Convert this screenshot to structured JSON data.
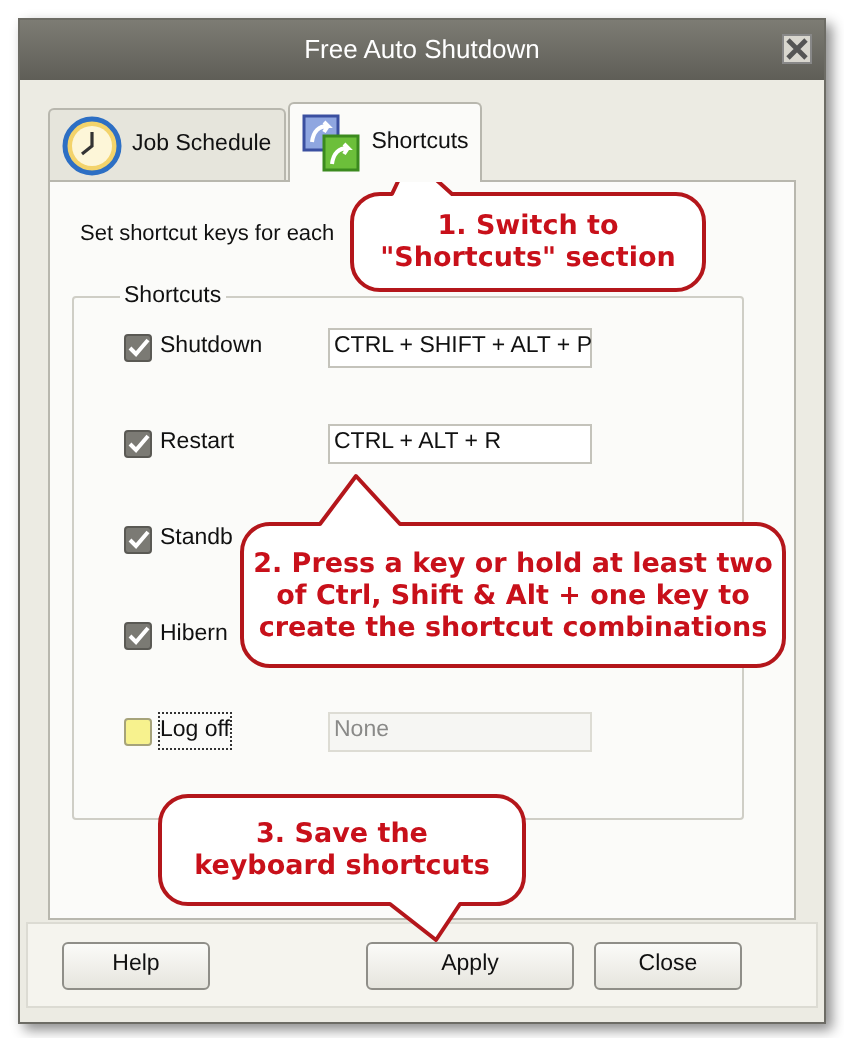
{
  "window": {
    "title": "Free Auto Shutdown"
  },
  "tabs": [
    {
      "label": "Job Schedule",
      "selected": false,
      "kind": "clock"
    },
    {
      "label": "Shortcuts",
      "selected": true,
      "kind": "shortcut"
    }
  ],
  "intro": "Set shortcut keys for each",
  "group": {
    "title": "Shortcuts",
    "rows": [
      {
        "label": "Shutdown",
        "checked": true,
        "shortcut": "CTRL + SHIFT + ALT + P"
      },
      {
        "label": "Restart",
        "checked": true,
        "shortcut": "CTRL + ALT + R"
      },
      {
        "label": "Standb",
        "checked": true
      },
      {
        "label": "Hibern",
        "checked": true
      },
      {
        "label": "Log off",
        "checked": false,
        "focused": true,
        "shortcut": "None"
      }
    ]
  },
  "buttons": [
    {
      "label": "Help"
    },
    {
      "label": "Apply"
    },
    {
      "label": "Close"
    }
  ],
  "callouts": [
    {
      "lines": [
        "1. Switch to",
        "\"Shortcuts\" section"
      ]
    },
    {
      "lines": [
        "2. Press a key or hold at least two",
        "of Ctrl, Shift & Alt + one key to",
        "create the shortcut combinations"
      ]
    },
    {
      "lines": [
        "3. Save the",
        "keyboard shortcuts"
      ]
    }
  ]
}
